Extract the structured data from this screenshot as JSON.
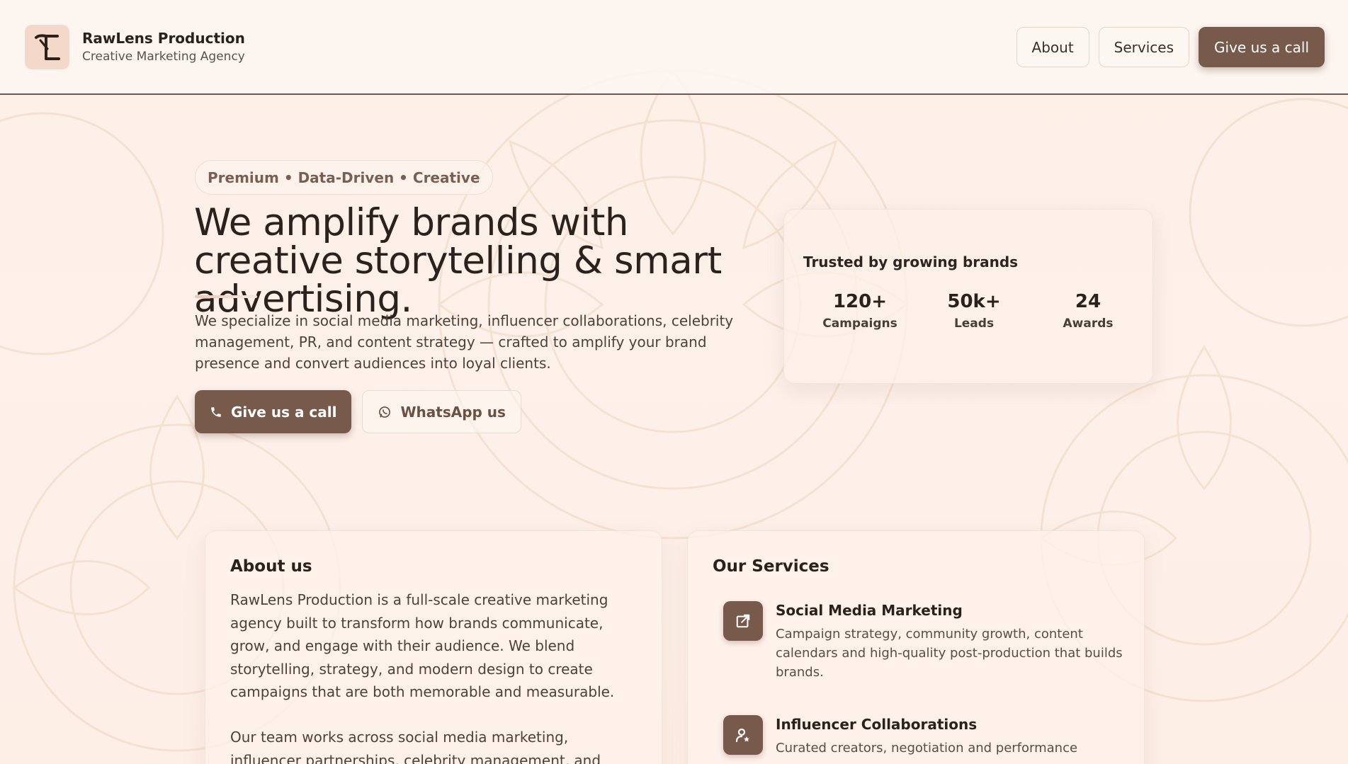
{
  "colors": {
    "accent": "#785a4b",
    "background": "#fdf1ea",
    "logo_bg": "#f4d9c9",
    "text": "#2b211d"
  },
  "header": {
    "brand_name": "RawLens Production",
    "brand_tagline": "Creative Marketing Agency",
    "logo_icon": "rl-monogram-logo",
    "nav": {
      "about_label": "About",
      "services_label": "Services",
      "call_label": "Give us a call"
    }
  },
  "hero": {
    "pill": "Premium • Data-Driven • Creative",
    "title": "We amplify brands with creative storytelling & smart advertising.",
    "description": "We specialize in social media marketing, influencer collaborations, celebrity management, PR, and content strategy — crafted to amplify your brand presence and convert audiences into loyal clients.",
    "call_button": {
      "label": "Give us a call",
      "icon": "phone-icon"
    },
    "whatsapp_button": {
      "label": "WhatsApp us",
      "icon": "whatsapp-icon"
    }
  },
  "stats": {
    "title": "Trusted by growing brands",
    "items": [
      {
        "value": "120+",
        "label": "Campaigns"
      },
      {
        "value": "50k+",
        "label": "Leads"
      },
      {
        "value": "24",
        "label": "Awards"
      }
    ]
  },
  "about": {
    "title": "About us",
    "paragraphs": [
      "RawLens Production is a full-scale creative marketing agency built to transform how brands communicate, grow, and engage with their audience. We blend storytelling, strategy, and modern design to create campaigns that are both memorable and measurable.",
      "Our team works across social media marketing, influencer partnerships, celebrity management, and high-end post-"
    ]
  },
  "services": {
    "title": "Our Services",
    "items": [
      {
        "name": "Social Media Marketing",
        "description": "Campaign strategy, community growth, content calendars and high-quality post-production that builds brands.",
        "icon": "external-link-icon"
      },
      {
        "name": "Influencer Collaborations",
        "description": "Curated creators, negotiation and performance",
        "icon": "user-star-icon"
      }
    ]
  }
}
